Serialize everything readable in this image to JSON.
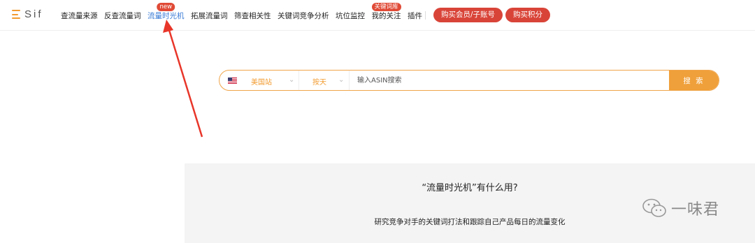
{
  "header": {
    "logo_text": "Sif",
    "menu": [
      {
        "label": "查流量来源"
      },
      {
        "label": "反查流量词"
      },
      {
        "label": "流量时光机",
        "badge": "new",
        "active": true
      },
      {
        "label": "拓展流量词"
      },
      {
        "label": "筛查相关性"
      },
      {
        "label": "关键词竞争分析"
      },
      {
        "label": "坑位监控"
      },
      {
        "label": "我的关注",
        "badge": "关键词库"
      },
      {
        "label": "插件"
      }
    ],
    "buy_member_label": "购买会员/子账号",
    "buy_points_label": "购买积分"
  },
  "search": {
    "site_label": "美国站",
    "period_label": "按天",
    "placeholder": "输入ASIN搜索",
    "button_label": "搜 索"
  },
  "info": {
    "question": "“流量时光机”有什么用?",
    "answer": "研究竞争对手的关键词打法和跟踪自己产品每日的流量变化"
  },
  "watermark": "一味君",
  "colors": {
    "accent": "#f0a03a",
    "danger": "#d94438",
    "link": "#3a7bd5"
  }
}
